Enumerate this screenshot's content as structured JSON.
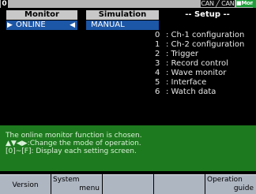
{
  "status_bar": {
    "screen_number": "0",
    "can_label": "CAN ╱ CAN",
    "mon_label": "■Mon",
    "colors": {
      "bar": "#b5b5b5",
      "mon": "#1ea03a"
    }
  },
  "monitor": {
    "header": "Monitor",
    "value": "ONLINE",
    "left_arrow": "▶",
    "right_arrow": "◀"
  },
  "simulation": {
    "header": "Simulation",
    "value": "MANUAL"
  },
  "setup": {
    "title": "-- Setup --",
    "items": [
      {
        "key": "0",
        "label": ": Ch-1 configuration"
      },
      {
        "key": "1",
        "label": ": Ch-2 configuration"
      },
      {
        "key": "2",
        "label": ": Trigger"
      },
      {
        "key": "3",
        "label": ": Record control"
      },
      {
        "key": "4",
        "label": ": Wave monitor"
      },
      {
        "key": "5",
        "label": ": Interface"
      },
      {
        "key": "6",
        "label": ": Watch data"
      }
    ]
  },
  "info_panel": {
    "line1": "The online monitor function is chosen.",
    "line2": "▲▼◀▶:Change the mode of operation.",
    "line3": "[0]~[F]: Display each setting screen.",
    "color": "#1e7a1e"
  },
  "function_keys": {
    "f1": "Version",
    "f2_line1": "System",
    "f2_line2": "menu",
    "f3": "",
    "f4": "",
    "f5_line1": "Operation",
    "f5_line2": "guide"
  }
}
